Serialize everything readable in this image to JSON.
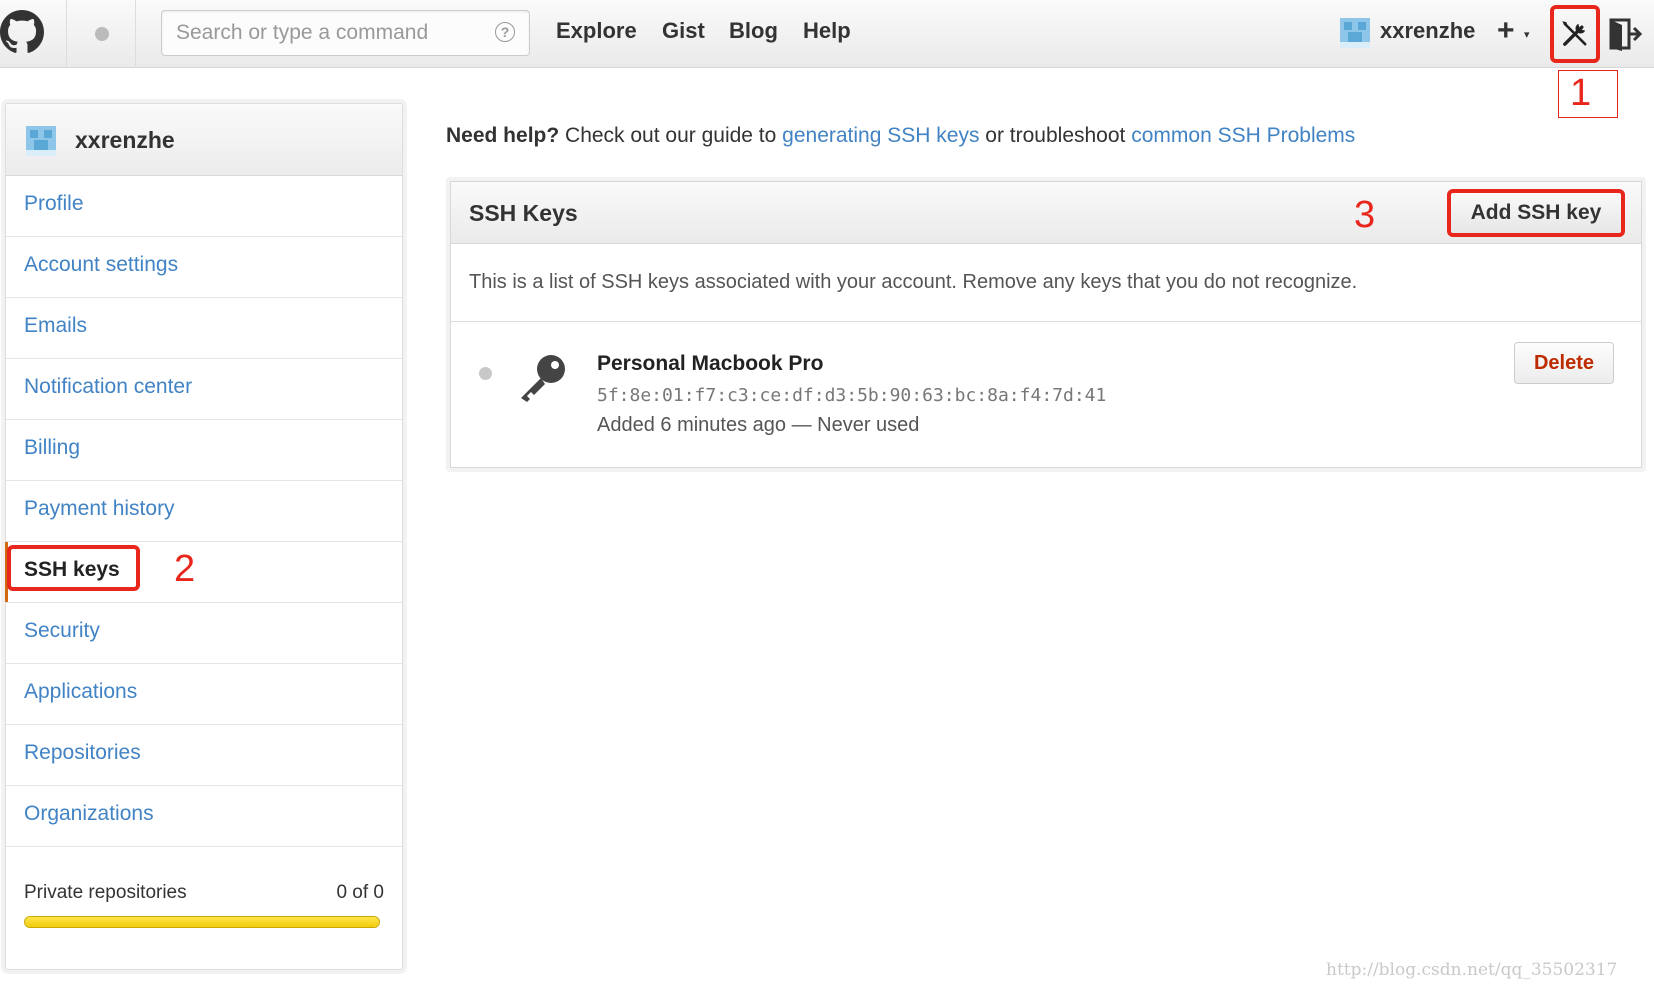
{
  "header": {
    "search_placeholder": "Search or type a command",
    "search_help": "?",
    "nav": [
      "Explore",
      "Gist",
      "Blog",
      "Help"
    ],
    "username": "xxrenzhe",
    "plus": "+",
    "plus_caret": "▾"
  },
  "annotations": {
    "one": "1",
    "two": "2",
    "three": "3"
  },
  "sidebar": {
    "username": "xxrenzhe",
    "items": [
      {
        "label": "Profile"
      },
      {
        "label": "Account settings"
      },
      {
        "label": "Emails"
      },
      {
        "label": "Notification center"
      },
      {
        "label": "Billing"
      },
      {
        "label": "Payment history"
      },
      {
        "label": "SSH keys"
      },
      {
        "label": "Security"
      },
      {
        "label": "Applications"
      },
      {
        "label": "Repositories"
      },
      {
        "label": "Organizations"
      }
    ],
    "private_repos_label": "Private repositories",
    "private_repos_count": "0 of 0",
    "private_repos_usage": 1.0
  },
  "main": {
    "help_prefix": "Need help?",
    "help_text1": " Check out our guide to ",
    "help_link1": "generating SSH keys",
    "help_text2": " or troubleshoot ",
    "help_link2": "common SSH Problems",
    "panel_title": "SSH Keys",
    "add_button": "Add SSH key",
    "description": "This is a list of SSH keys associated with your account. Remove any keys that you do not recognize.",
    "key": {
      "title": "Personal Macbook Pro",
      "fingerprint": "5f:8e:01:f7:c3:ce:df:d3:5b:90:63:bc:8a:f4:7d:41",
      "meta": "Added 6 minutes ago — Never used",
      "delete_label": "Delete"
    }
  },
  "watermark": "http://blog.csdn.net/qq_35502317",
  "colors": {
    "link": "#4183c4",
    "highlight": "#e8261c",
    "delete": "#bd2c00",
    "active_bar": "#d26911"
  },
  "icons": [
    "github-logo-icon",
    "help-circle-icon",
    "avatar-icon",
    "tools-icon",
    "sign-out-icon",
    "key-icon"
  ]
}
